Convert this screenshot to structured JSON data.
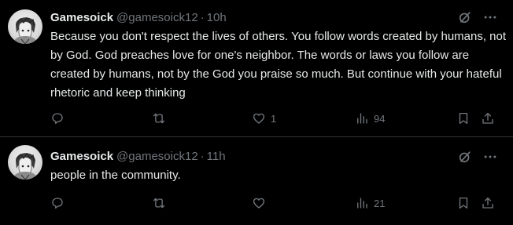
{
  "tweets": [
    {
      "display_name": "Gamesoick",
      "handle": "@gamesoick12",
      "separator": "·",
      "time": "10h",
      "text": "Because you don't respect the lives of others. You follow words created by humans, not by God. God preaches love for one's neighbor. The words or laws you follow are created by humans, not by the God you praise so much. But continue with your hateful rhetoric and keep thinking",
      "stats": {
        "replies": "",
        "reposts": "",
        "likes": "1",
        "views": "94"
      }
    },
    {
      "display_name": "Gamesoick",
      "handle": "@gamesoick12",
      "separator": "·",
      "time": "11h",
      "text": "people in the community.",
      "stats": {
        "replies": "",
        "reposts": "",
        "likes": "",
        "views": "21"
      }
    }
  ],
  "icons": {
    "reply": "reply-icon",
    "repost": "repost-icon",
    "like": "heart-icon",
    "views": "views-icon",
    "bookmark": "bookmark-icon",
    "share": "share-icon",
    "grok": "grok-icon",
    "more": "more-icon"
  },
  "colors": {
    "background": "#000000",
    "primary_text": "#e7e9ea",
    "secondary_text": "#71767b",
    "divider": "#2f3336"
  }
}
